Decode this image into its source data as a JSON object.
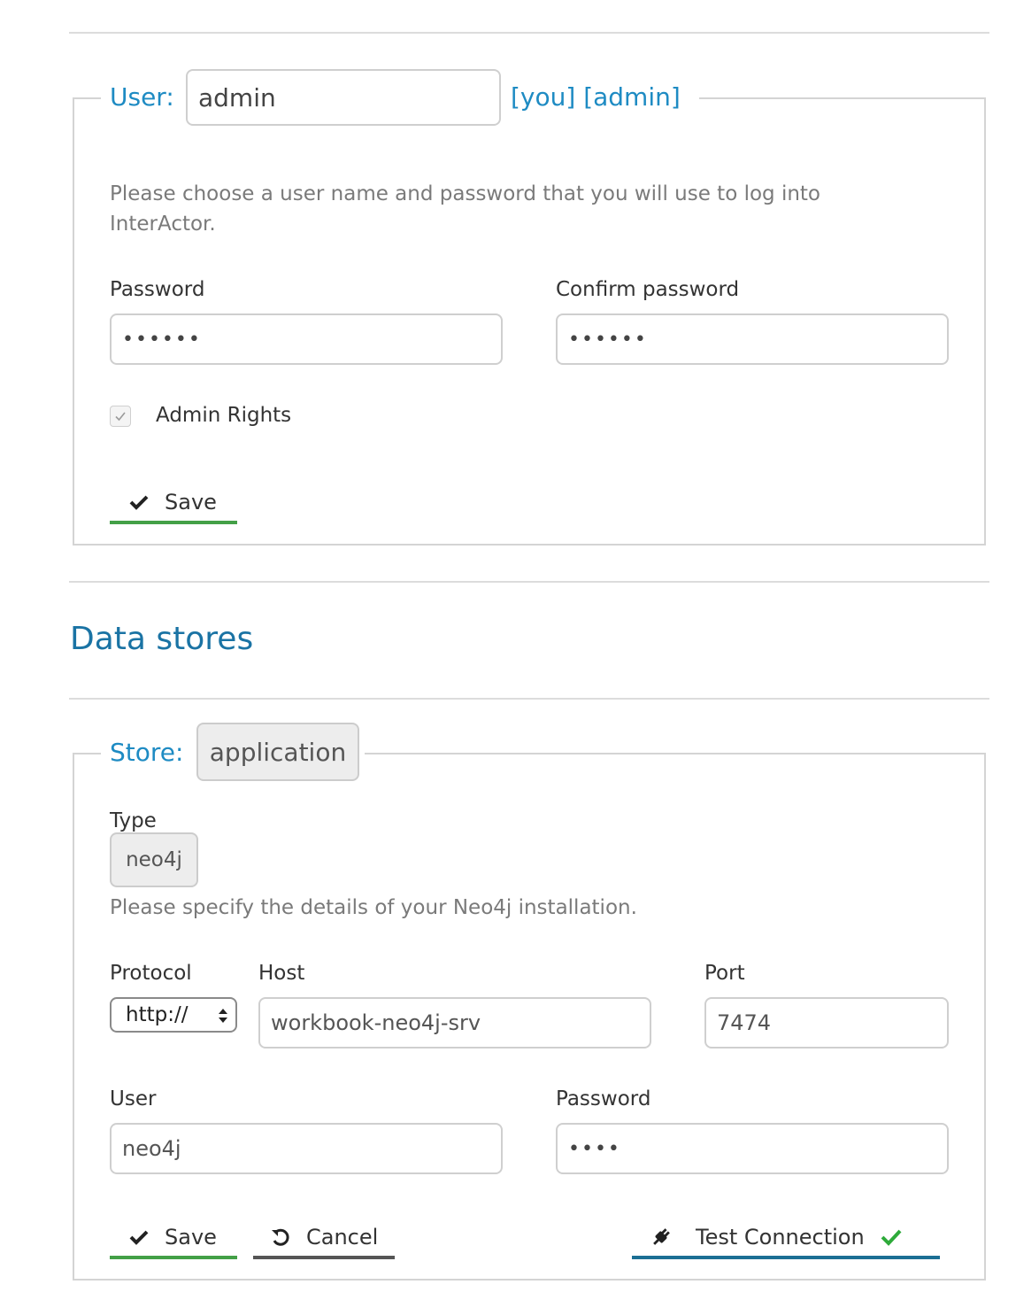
{
  "user_section": {
    "legend_label": "User:",
    "username_value": "admin",
    "tags": "[you] [admin]",
    "help_text_line1": "Please choose a user name and password that you will use to log into",
    "help_text_line2": "InterActor.",
    "password_label": "Password",
    "password_mask": "••••••",
    "confirm_label": "Confirm password",
    "confirm_mask": "••••••",
    "admin_checkbox_label": "Admin Rights",
    "admin_checked": true,
    "save_label": "Save"
  },
  "data_stores": {
    "heading": "Data stores",
    "store_label": "Store:",
    "store_name": "application",
    "type_label": "Type",
    "type_value": "neo4j",
    "help_text": "Please specify the details of your Neo4j installation.",
    "protocol_label": "Protocol",
    "protocol_value": "http://",
    "host_label": "Host",
    "host_value": "workbook-neo4j-srv",
    "port_label": "Port",
    "port_value": "7474",
    "user_label": "User",
    "user_value": "neo4j",
    "password_label": "Password",
    "password_mask": "••••",
    "save_label": "Save",
    "cancel_label": "Cancel",
    "test_label": "Test Connection"
  },
  "colors": {
    "accent_blue": "#1e8bc3",
    "save_green": "#43a047",
    "cancel_gray": "#555555",
    "test_blue": "#1b6f94",
    "success_check": "#2eaa3a"
  }
}
